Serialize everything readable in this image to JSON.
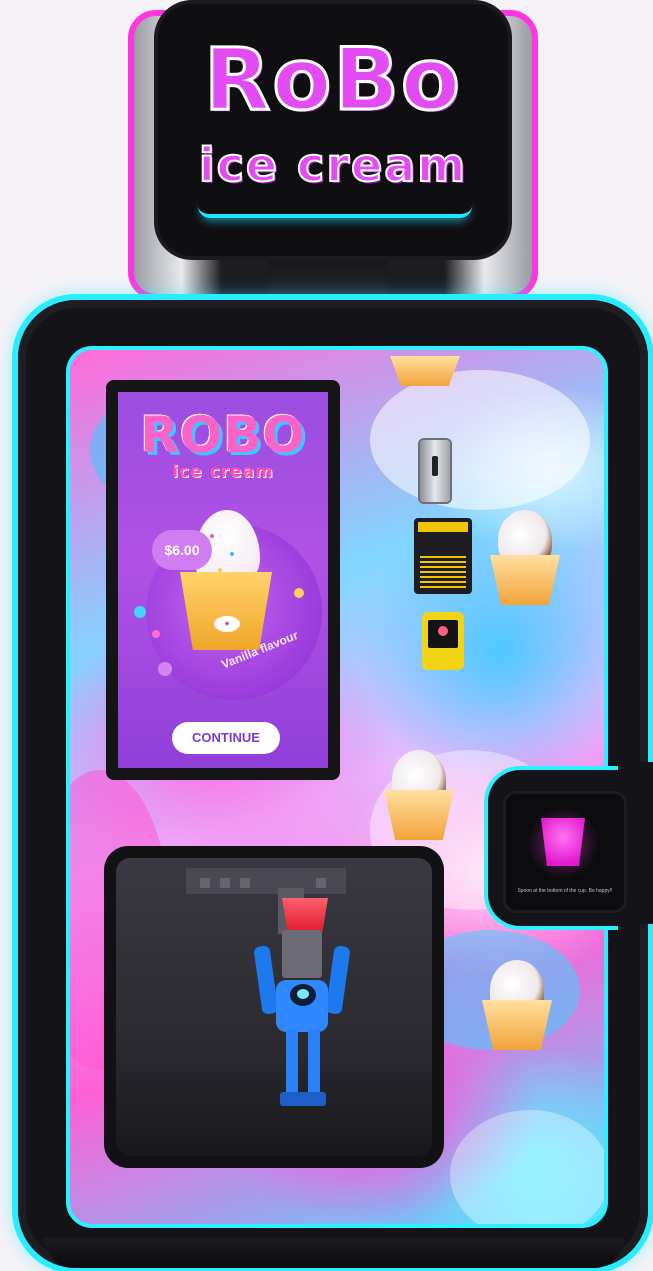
{
  "sign": {
    "title": "RoBo",
    "subtitle": "ice cream"
  },
  "screen": {
    "brand_title": "ROBO",
    "brand_subtitle": "ice cream",
    "price": "$6.00",
    "flavour": "Vanilla flavour",
    "continue_label": "CONTINUE"
  },
  "pickup": {
    "instructions": "Spoon at the bottom of the cup. Be happy!!"
  },
  "colors": {
    "neon_cyan": "#29ecff",
    "neon_magenta": "#ff35e1",
    "brand_purple": "#e34cf3",
    "screen_purple": "#9b4de0"
  },
  "icons": {
    "coin_slot": "coin-slot-icon",
    "bill_acceptor": "bill-acceptor-icon",
    "card_reader": "card-reader-icon"
  }
}
